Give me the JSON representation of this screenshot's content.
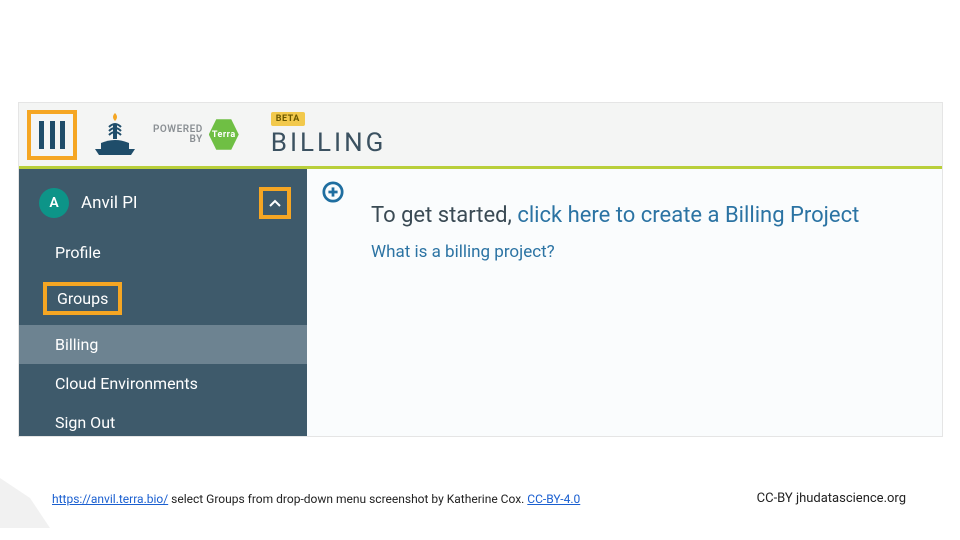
{
  "header": {
    "powered_label_top": "POWERED",
    "powered_label_bottom": "BY",
    "terra_text": "Terra",
    "beta_badge": "BETA",
    "page_title": "BILLING"
  },
  "sidebar": {
    "avatar_letter": "A",
    "user_name": "Anvil PI",
    "items": [
      {
        "label": "Profile",
        "selected": false,
        "highlighted": false
      },
      {
        "label": "Groups",
        "selected": false,
        "highlighted": true
      },
      {
        "label": "Billing",
        "selected": true,
        "highlighted": false
      },
      {
        "label": "Cloud Environments",
        "selected": false,
        "highlighted": false
      },
      {
        "label": "Sign Out",
        "selected": false,
        "highlighted": false
      }
    ]
  },
  "content": {
    "cta_prefix": "To get started, ",
    "cta_link": "click here to create a Billing Project",
    "help_link": "What is a billing project?"
  },
  "footer": {
    "url": "https://anvil.terra.bio/",
    "caption": " select Groups from drop-down menu screenshot by Katherine Cox.  ",
    "license": "CC-BY-4.0",
    "right": "CC-BY  jhudatascience.org"
  },
  "colors": {
    "highlight": "#f5a623",
    "sidebar_bg": "#3e5a6b",
    "accent": "#2b73a3"
  }
}
